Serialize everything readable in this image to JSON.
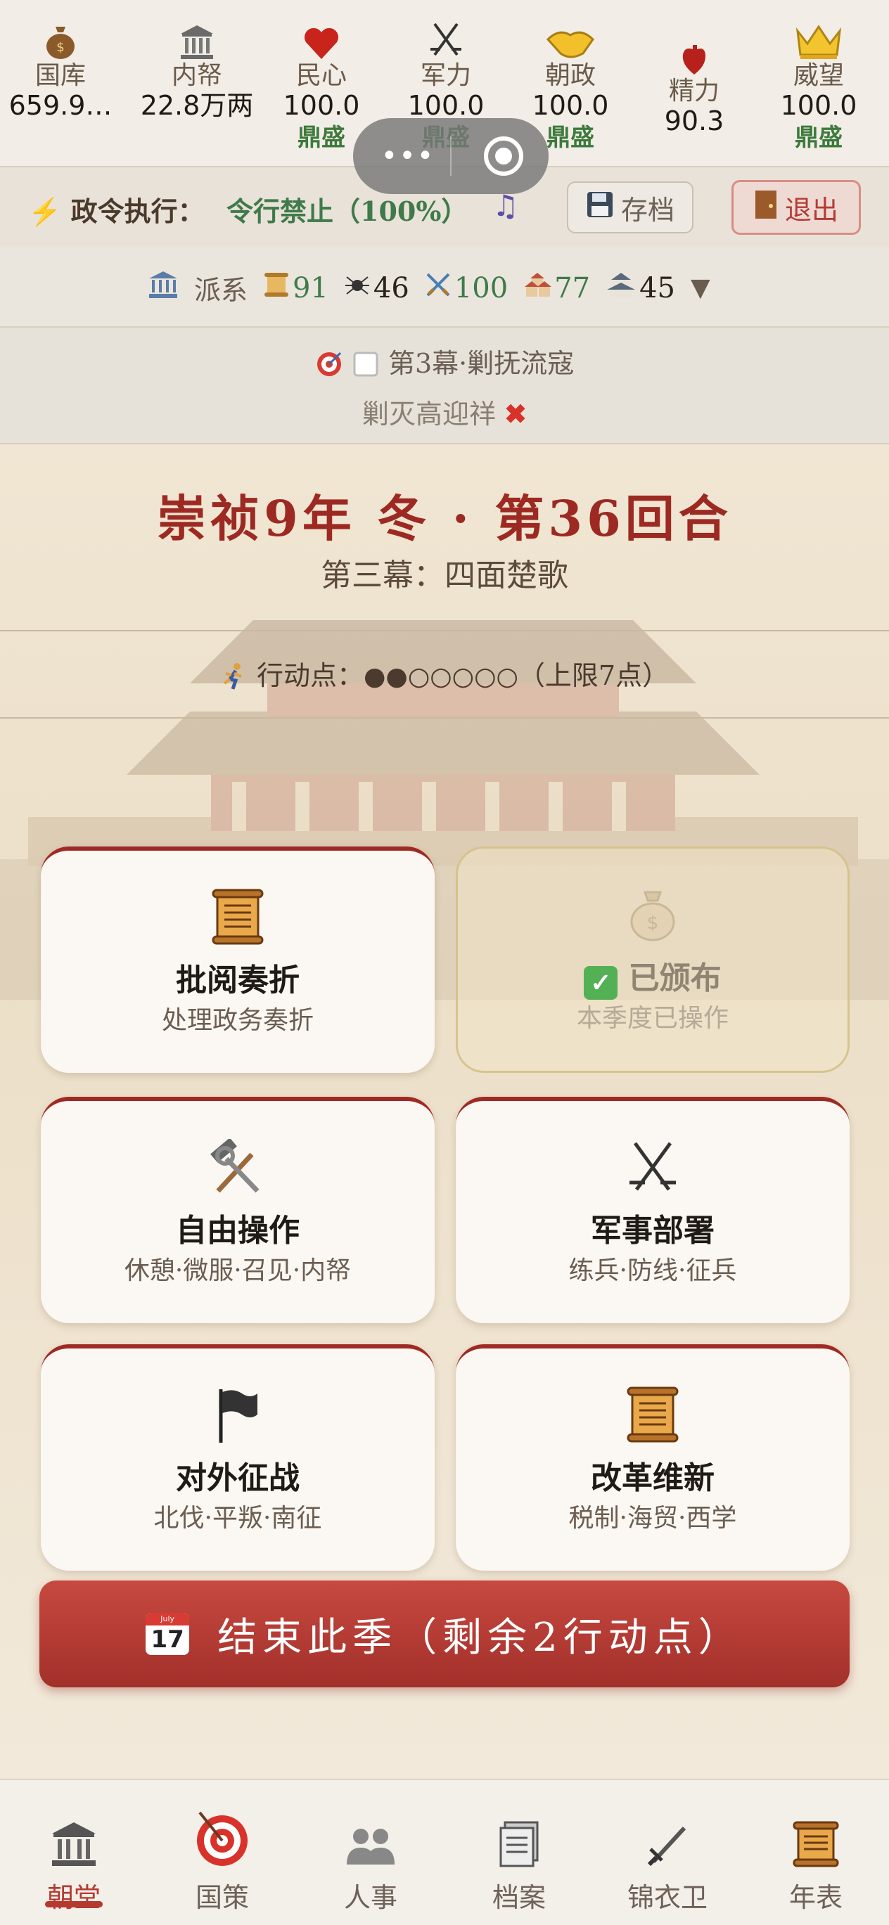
{
  "stats": [
    {
      "label": "国库",
      "value": "659.9…",
      "status": "",
      "icon": "money-bag-icon"
    },
    {
      "label": "内帑",
      "value": "22.8万两",
      "status": "",
      "icon": "bank-icon"
    },
    {
      "label": "民心",
      "value": "100.0",
      "status": "鼎盛",
      "icon": "heart-icon"
    },
    {
      "label": "军力",
      "value": "100.0",
      "status": "鼎盛",
      "icon": "crossed-swords-icon"
    },
    {
      "label": "朝政",
      "value": "100.0",
      "status": "鼎盛",
      "icon": "handshake-icon"
    },
    {
      "label": "精力",
      "value": "90.3",
      "status": "",
      "icon": "anatomical-heart-icon"
    },
    {
      "label": "威望",
      "value": "100.0",
      "status": "鼎盛",
      "icon": "crown-icon"
    }
  ],
  "decree": {
    "label": "政令执行：",
    "value": "令行禁止（100%）",
    "save_label": "存档",
    "exit_label": "退出"
  },
  "faction": {
    "label": "派系",
    "items": [
      {
        "icon": "scroll-icon",
        "value": "91",
        "color": "#3f7a4a"
      },
      {
        "icon": "spider-icon",
        "value": "46",
        "color": "#2a221b"
      },
      {
        "icon": "crossed-swords-icon",
        "value": "100",
        "color": "#3f7a4a"
      },
      {
        "icon": "houses-icon",
        "value": "77",
        "color": "#3f7a4a"
      },
      {
        "icon": "castle-icon",
        "value": "45",
        "color": "#2a221b"
      }
    ]
  },
  "objective": {
    "line1": "第3幕·剿抚流寇",
    "line2": "剿灭高迎祥"
  },
  "round": {
    "title": "崇祯9年 冬 · 第36回合",
    "act": "第三幕：四面楚歌",
    "action_label": "行动点：",
    "action_dots": "●●○○○○○",
    "action_limit": "（上限7点）"
  },
  "cards": [
    {
      "title": "批阅奏折",
      "sub": "处理政务奏折",
      "icon": "scroll-icon"
    },
    {
      "title": "已颁布",
      "sub": "本季度已操作",
      "icon": "money-bag-icon"
    },
    {
      "title": "自由操作",
      "sub": "休憩·微服·召见·内帑",
      "icon": "hammer-wrench-icon"
    },
    {
      "title": "军事部署",
      "sub": "练兵·防线·征兵",
      "icon": "crossed-swords-icon"
    },
    {
      "title": "对外征战",
      "sub": "北伐·平叛·南征",
      "icon": "black-flag-icon"
    },
    {
      "title": "改革维新",
      "sub": "税制·海贸·西学",
      "icon": "scroll-icon"
    }
  ],
  "end_button": {
    "label": "结束此季（剩余2行动点）",
    "cal_month": "July",
    "cal_day": "17"
  },
  "nav": [
    {
      "label": "朝堂",
      "icon": "classical-building-icon",
      "active": true
    },
    {
      "label": "国策",
      "icon": "target-icon",
      "active": false
    },
    {
      "label": "人事",
      "icon": "people-icon",
      "active": false
    },
    {
      "label": "档案",
      "icon": "documents-icon",
      "active": false
    },
    {
      "label": "锦衣卫",
      "icon": "dagger-icon",
      "active": false
    },
    {
      "label": "年表",
      "icon": "scroll-icon",
      "active": false
    }
  ],
  "colors": {
    "accent_red": "#9c2a22",
    "status_green": "#3d7a3d",
    "button_red": "#b53a30"
  }
}
